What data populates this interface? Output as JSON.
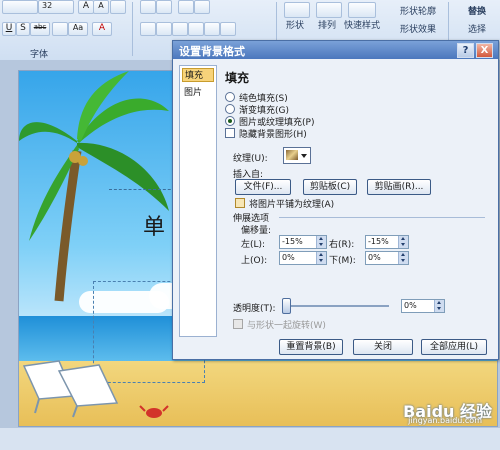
{
  "ribbon": {
    "font_size_value": "32",
    "font_group_label": "字体",
    "shape_label": "形状",
    "arrange_label": "排列",
    "quick_style_label": "快速样式",
    "shape_outline_label": "形状轮廓",
    "shape_effect_label": "形状效果",
    "replace_label": "替换",
    "select_label": "选择",
    "u_label": "U",
    "s_label": "S",
    "abc_label": "abc",
    "a_label": "A",
    "aa_label": "Aa"
  },
  "slide": {
    "title_fragment": "单"
  },
  "dialog": {
    "title": "设置背景格式",
    "help_label": "?",
    "close_label": "X",
    "nav": [
      "填充",
      "图片"
    ],
    "section_title": "填充",
    "radio_options": [
      "纯色填充(S)",
      "渐变填充(G)",
      "图片或纹理填充(P)"
    ],
    "selected_option": "图片或纹理填充(P)",
    "hide_bg_label": "隐藏背景图形(H)",
    "texture_label": "纹理(U):",
    "insert_from_label": "插入自:",
    "file_button": "文件(F)...",
    "clipboard_button": "剪贴板(C)",
    "clipart_button": "剪贴画(R)...",
    "tile_label": "将图片平铺为纹理(A)",
    "stretch_label": "伸展选项",
    "offset_label": "偏移量:",
    "left_label": "左(L):",
    "left_value": "-15%",
    "right_label": "右(R):",
    "right_value": "-15%",
    "top_label": "上(O):",
    "top_value": "0%",
    "bottom_label": "下(M):",
    "bottom_value": "0%",
    "transparency_label": "透明度(T):",
    "transparency_value": "0%",
    "transparency_level": 0,
    "rotate_label": "与形状一起旋转(W)",
    "reset_button": "重置背景(B)",
    "close_button": "关闭",
    "apply_all_button": "全部应用(L)"
  },
  "watermark": {
    "brand": "Baidu 经验",
    "url": "jingyan.baidu.com"
  },
  "colors": {
    "accent": "#4b77bd",
    "sky": "#36a5ea",
    "sand": "#e7bd55"
  }
}
